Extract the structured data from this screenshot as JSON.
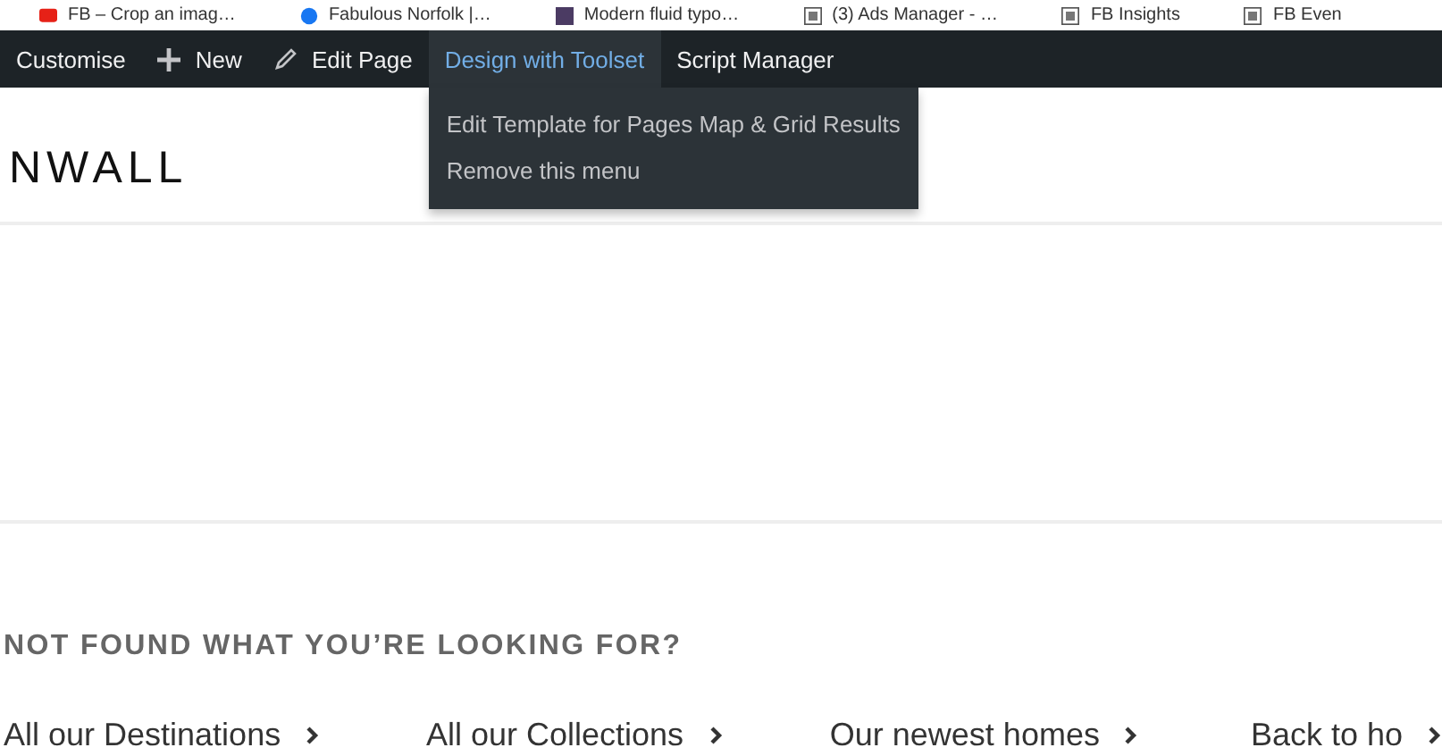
{
  "bookmarks": [
    {
      "label": "FB – Crop an imag…",
      "kind": "video"
    },
    {
      "label": "Fabulous Norfolk |…",
      "kind": "facebook"
    },
    {
      "label": "Modern fluid typo…",
      "kind": "site"
    },
    {
      "label": "(3) Ads Manager - …",
      "kind": "page"
    },
    {
      "label": "FB Insights",
      "kind": "page"
    },
    {
      "label": "FB Even",
      "kind": "page"
    }
  ],
  "admin_bar": {
    "items": [
      {
        "label": "Customise",
        "kind": "text",
        "selected": false
      },
      {
        "label": "New",
        "kind": "add",
        "selected": false
      },
      {
        "label": "Edit Page",
        "kind": "edit",
        "selected": false
      },
      {
        "label": "Design with Toolset",
        "kind": "text",
        "selected": true
      },
      {
        "label": "Script Manager",
        "kind": "text",
        "selected": false
      }
    ],
    "dropdown": [
      "Edit Template for Pages Map & Grid Results",
      "Remove this menu"
    ]
  },
  "logo": "NWALL",
  "section": {
    "heading": "NOT FOUND WHAT YOU’RE LOOKING FOR?",
    "links": [
      "All our Destinations",
      "All our Collections",
      "Our newest homes",
      "Back to ho"
    ]
  }
}
